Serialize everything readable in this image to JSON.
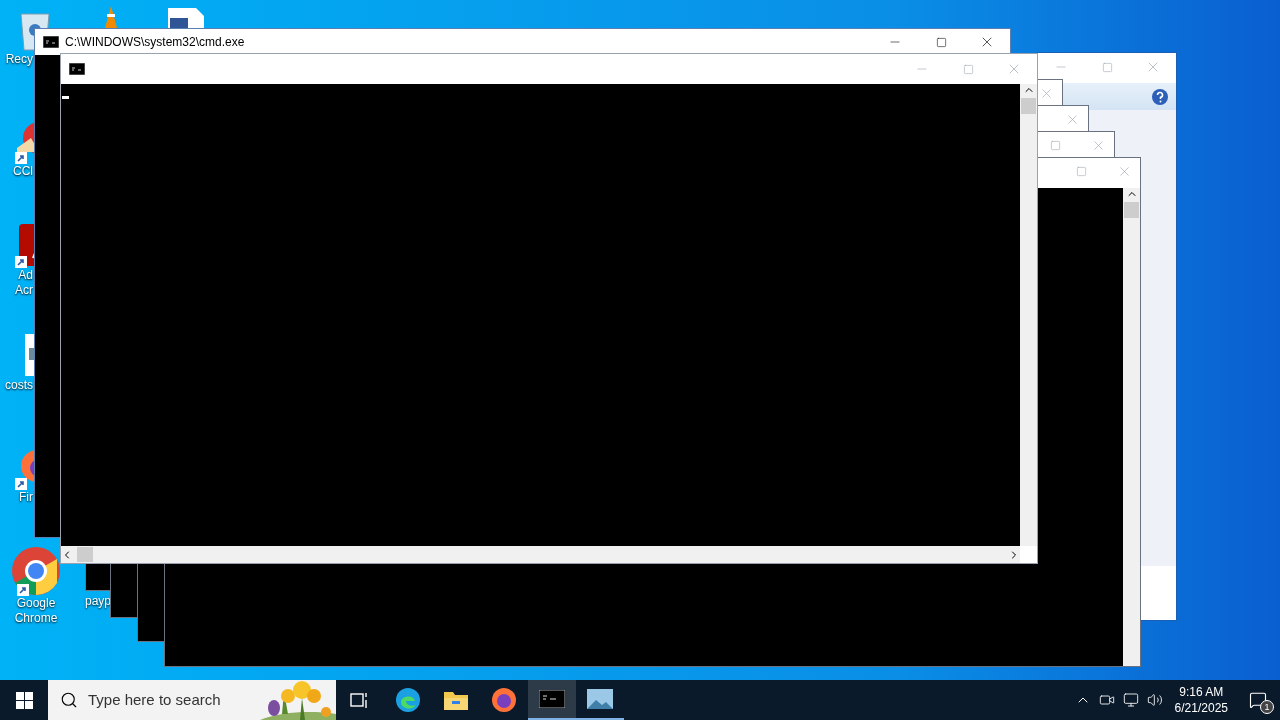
{
  "desktop_icons": [
    {
      "kind": "recycle-bin",
      "shortcut": false,
      "lines": [
        "Recy"
      ]
    },
    {
      "kind": "cleaner",
      "shortcut": true,
      "lines": [
        "CCl"
      ]
    },
    {
      "kind": "pdf-reader",
      "shortcut": true,
      "lines": [
        "Ad",
        "Acr"
      ]
    },
    {
      "kind": "document",
      "shortcut": false,
      "lines": [
        "costs"
      ]
    },
    {
      "kind": "firefox",
      "shortcut": true,
      "lines": [
        "Fir"
      ]
    },
    {
      "kind": "chrome",
      "shortcut": true,
      "lines": [
        "Google",
        "Chrome"
      ]
    },
    {
      "kind": "file",
      "shortcut": false,
      "lines": [
        "payp"
      ]
    }
  ],
  "console_window": {
    "title": "C:\\WINDOWS\\system32\\cmd.exe",
    "active": true
  },
  "front_console_window": {
    "active": false
  },
  "taskbar": {
    "search": {
      "placeholder": "Type here to search"
    },
    "apps": [
      {
        "kind": "task-view",
        "selected": false,
        "running": false
      },
      {
        "kind": "edge",
        "selected": false,
        "running": false
      },
      {
        "kind": "explorer",
        "selected": false,
        "running": false
      },
      {
        "kind": "firefox",
        "selected": false,
        "running": false
      },
      {
        "kind": "console",
        "selected": true,
        "running": true
      },
      {
        "kind": "photos",
        "selected": false,
        "running": true
      }
    ],
    "clock": {
      "time": "9:16 AM",
      "date": "6/21/2025"
    },
    "notifications": {
      "count": "1"
    }
  }
}
